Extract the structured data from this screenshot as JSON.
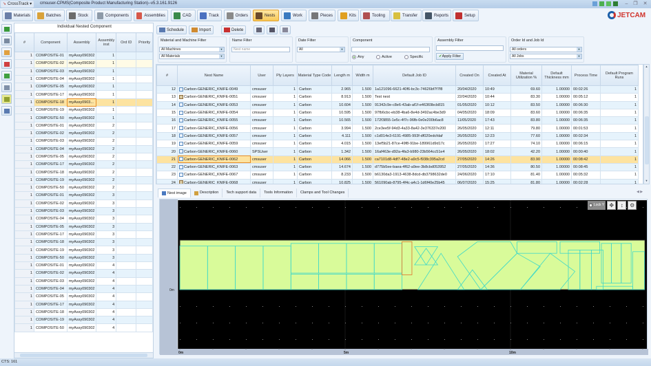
{
  "titlebar": {
    "app_menu": "CrossTrack",
    "title": "cmsuser-CPMS(Composite Product Manufacturing Station)--v5.3.161.9126"
  },
  "toolbar": {
    "items": [
      {
        "label": "Materials",
        "icon": "materials-icon",
        "color": "#6b7fa8"
      },
      {
        "label": "Batches",
        "icon": "box-icon",
        "color": "#d9a23a"
      },
      {
        "label": "Stock",
        "icon": "stack-icon",
        "color": "#6b6b6b"
      },
      {
        "label": "Components",
        "icon": "component-icon",
        "color": "#8d9aa8"
      },
      {
        "label": "Assemblies",
        "icon": "assemblies-icon",
        "color": "#d6584a"
      },
      {
        "label": "CAD",
        "icon": "cad-icon",
        "color": "#3a8a4a"
      },
      {
        "label": "Track",
        "icon": "chart-icon",
        "color": "#4a70c0"
      },
      {
        "label": "Orders",
        "icon": "orders-icon",
        "color": "#8a8a8a"
      },
      {
        "label": "Nests",
        "icon": "nests-icon",
        "color": "#6a4a2a",
        "active": true
      },
      {
        "label": "Work",
        "icon": "work-icon",
        "color": "#3a7ac0"
      },
      {
        "label": "Pieces",
        "icon": "pieces-icon",
        "color": "#777777"
      },
      {
        "label": "Kits",
        "icon": "kits-icon",
        "color": "#e0a020"
      },
      {
        "label": "Tooling",
        "icon": "tooling-icon",
        "color": "#b05050"
      },
      {
        "label": "Transfer",
        "icon": "forklift-icon",
        "color": "#d8c040"
      },
      {
        "label": "Reports",
        "icon": "grid-icon",
        "color": "#445566"
      },
      {
        "label": "Setup",
        "icon": "tools-icon",
        "color": "#c03030"
      }
    ]
  },
  "logo": "JETCAM",
  "left_panel": {
    "title": "Individual Nested Component",
    "columns": [
      "#",
      "Component",
      "Assembly",
      "Assembly inst",
      "Ord ID",
      "Priority"
    ],
    "assembly": "myAssy090302",
    "selected_assembly_truncated": "myAssy0903...",
    "rows": [
      [
        "1",
        "COMPOSITE-01",
        "myAssy090302",
        "1"
      ],
      [
        "1",
        "COMPOSITE-02",
        "myAssy090302",
        "1"
      ],
      [
        "1",
        "COMPOSITE-03",
        "myAssy090302",
        "1"
      ],
      [
        "1",
        "COMPOSITE-04",
        "myAssy090302",
        "1"
      ],
      [
        "1",
        "COMPOSITE-05",
        "myAssy090302",
        "1"
      ],
      [
        "1",
        "COMPOSITE-17",
        "myAssy090302",
        "1"
      ],
      [
        "1",
        "COMPOSITE-18",
        "myAssy0903...",
        "1"
      ],
      [
        "1",
        "COMPOSITE-19",
        "myAssy090302",
        "1"
      ],
      [
        "1",
        "COMPOSITE-50",
        "myAssy090302",
        "1"
      ],
      [
        "1",
        "COMPOSITE-01",
        "myAssy090302",
        "2"
      ],
      [
        "1",
        "COMPOSITE-02",
        "myAssy090302",
        "2"
      ],
      [
        "1",
        "COMPOSITE-03",
        "myAssy090302",
        "2"
      ],
      [
        "1",
        "COMPOSITE-04",
        "myAssy090302",
        "2"
      ],
      [
        "1",
        "COMPOSITE-05",
        "myAssy090302",
        "2"
      ],
      [
        "1",
        "COMPOSITE-17",
        "myAssy090302",
        "2"
      ],
      [
        "1",
        "COMPOSITE-18",
        "myAssy090302",
        "2"
      ],
      [
        "1",
        "COMPOSITE-19",
        "myAssy090302",
        "2"
      ],
      [
        "1",
        "COMPOSITE-50",
        "myAssy090302",
        "2"
      ],
      [
        "1",
        "COMPOSITE-01",
        "myAssy090302",
        "3"
      ],
      [
        "1",
        "COMPOSITE-02",
        "myAssy090302",
        "3"
      ],
      [
        "1",
        "COMPOSITE-03",
        "myAssy090302",
        "3"
      ],
      [
        "1",
        "COMPOSITE-04",
        "myAssy090302",
        "3"
      ],
      [
        "1",
        "COMPOSITE-05",
        "myAssy090302",
        "3"
      ],
      [
        "1",
        "COMPOSITE-17",
        "myAssy090302",
        "3"
      ],
      [
        "1",
        "COMPOSITE-18",
        "myAssy090302",
        "3"
      ],
      [
        "1",
        "COMPOSITE-19",
        "myAssy090302",
        "3"
      ],
      [
        "1",
        "COMPOSITE-50",
        "myAssy090302",
        "3"
      ],
      [
        "1",
        "COMPOSITE-01",
        "myAssy090302",
        "4"
      ],
      [
        "1",
        "COMPOSITE-02",
        "myAssy090302",
        "4"
      ],
      [
        "1",
        "COMPOSITE-03",
        "myAssy090302",
        "4"
      ],
      [
        "1",
        "COMPOSITE-04",
        "myAssy090302",
        "4"
      ],
      [
        "1",
        "COMPOSITE-05",
        "myAssy090302",
        "4"
      ],
      [
        "1",
        "COMPOSITE-17",
        "myAssy090302",
        "4"
      ],
      [
        "1",
        "COMPOSITE-18",
        "myAssy090302",
        "4"
      ],
      [
        "1",
        "COMPOSITE-19",
        "myAssy090302",
        "4"
      ],
      [
        "1",
        "COMPOSITE-50",
        "myAssy090302",
        "4"
      ]
    ],
    "selected_row": 6,
    "hover_row": 1
  },
  "actions": {
    "schedule": "Schedule",
    "import": "Import",
    "delete": "Delete"
  },
  "filters": {
    "material_machine": {
      "label": "Material and Machine Filter",
      "machine": "All Machines",
      "material": "All Materials"
    },
    "name": {
      "label": "Name Filter",
      "placeholder": "Nest name"
    },
    "date": {
      "label": "Date Filter",
      "value": "All"
    },
    "component": {
      "label": "Component",
      "value": "",
      "options": [
        "Any",
        "Active",
        "Specific"
      ],
      "selected": "Any"
    },
    "assembly": {
      "label": "Assembly Filter",
      "value": "",
      "apply": "Apply Filter"
    },
    "order_job": {
      "label": "Order Id and Job Id",
      "orders": "All orders",
      "jobs": "All Jobs"
    }
  },
  "nests": {
    "columns": [
      "#",
      "Nest Name",
      "User",
      "Ply Layers",
      "Material Type Code",
      "Length m",
      "Width m",
      "Default Job ID",
      "Created On",
      "Created At",
      "Material Utilization %",
      "Default Thickness mm",
      "Process Time",
      "Default Program Runs"
    ],
    "rows": [
      [
        "12",
        "Carbon-GENERIC_KNIFE-0049",
        "cmsuser",
        "1",
        "Carbon",
        "2.965",
        "1.500",
        "1a121096-6621-40f6-bc3c-74626bf7f7f8",
        "20/04/2020",
        "10:49",
        "69.60",
        "1.00000",
        "00:02:26",
        "1"
      ],
      [
        "13",
        "Carbon-GENERIC_KNIFE-0051",
        "cmsuser",
        "1",
        "Carbon",
        "8.913",
        "1.500",
        "Test nest",
        "22/04/2020",
        "10:44",
        "83.30",
        "1.00000",
        "00:05:12",
        "1"
      ],
      [
        "14",
        "Carbon-GENERIC_KNIFE-0053",
        "cmsuser",
        "1",
        "Carbon",
        "10.604",
        "1.500",
        "91342c9e-c8e6-43ab-af1f-e46369bcb815",
        "01/05/2020",
        "10:12",
        "83.50",
        "1.00000",
        "00:06:30",
        "1"
      ],
      [
        "15",
        "Carbon-GENERIC_KNIFE-0054",
        "cmsuser",
        "1",
        "Carbon",
        "10.595",
        "1.500",
        "97fb6cbc-eb38-4ba6-8e4d-3492ac4be3d9",
        "04/05/2020",
        "18:09",
        "83.60",
        "1.00000",
        "00:06:35",
        "1"
      ],
      [
        "16",
        "Carbon-GENERIC_KNIFE-0055",
        "cmsuser",
        "1",
        "Carbon",
        "10.565",
        "1.500",
        "172f3855-1e5c-4f7c-96fb-0e0e200b6ac8",
        "11/05/2020",
        "17:43",
        "83.80",
        "1.00000",
        "00:06:35",
        "1"
      ],
      [
        "17",
        "Carbon-GENERIC_KNIFE-0056",
        "cmsuser",
        "1",
        "Carbon",
        "3.994",
        "1.500",
        "2ce3ee5f-94d3-4a33-8a42-3e376337e200",
        "26/05/2020",
        "12:11",
        "79.80",
        "1.00000",
        "00:01:53",
        "1"
      ],
      [
        "18",
        "Carbon-GENERIC_KNIFE-0057",
        "cmsuser",
        "1",
        "Carbon",
        "4.111",
        "1.500",
        "c1d014e3-6191-4985-993f-df020edcfdaf",
        "26/05/2020",
        "12:23",
        "77.60",
        "1.00000",
        "00:02:34",
        "1"
      ],
      [
        "19",
        "Carbon-GENERIC_KNIFE-0059",
        "cmsuser",
        "1",
        "Carbon",
        "4.015",
        "1.500",
        "13ef5b21-87ce-49f8-91be-189961d9d17c",
        "26/05/2020",
        "17:27",
        "74.10",
        "1.00000",
        "00:06:15",
        "1"
      ],
      [
        "20",
        "Carbon-GENERIC_KNIFE-0060",
        "SPSUser",
        "1",
        "Carbon",
        "1.342",
        "1.500",
        "16af463e-d92a-4fa3-b980-23b564cc51e4",
        "26/05/2020",
        "18:02",
        "42.20",
        "1.00000",
        "00:00:40",
        "1"
      ],
      [
        "21",
        "Carbon-GENERIC_KNIFE-0062",
        "cmsuser",
        "1",
        "Carbon",
        "14.066",
        "1.500",
        "ca7101d8-4df7-48e2-a9c5-f938c395a2cd",
        "27/05/2020",
        "14:26",
        "83.90",
        "1.00000",
        "00:08:42",
        "1"
      ],
      [
        "22",
        "Carbon-GENERIC_KNIFE-0063",
        "cmsuser",
        "1",
        "Carbon",
        "14.674",
        "1.500",
        "d775b5ee-baea-4f62-a9ee-3b8cbd053952",
        "27/05/2020",
        "14:36",
        "80.50",
        "1.00000",
        "00:08:45",
        "1"
      ],
      [
        "23",
        "Carbon-GENERIC_KNIFE-0067",
        "cmsuser",
        "1",
        "Carbon",
        "8.233",
        "1.500",
        "b6130da3-1913-4638-8dcd-db3798632de0",
        "24/06/2020",
        "17:10",
        "81.40",
        "1.00000",
        "00:05:32",
        "1"
      ],
      [
        "24",
        "Carbon-GENERIC_KNIFE-0068",
        "cmsuser",
        "1",
        "Carbon",
        "10.825",
        "1.500",
        "561090ab-8795-4f4c-a4c1-1d6f40e25b45",
        "06/07/2020",
        "15:25",
        "81.80",
        "1.00000",
        "00:02:28",
        "1"
      ]
    ],
    "selected_row": 9,
    "alt_icon_rows": [
      1,
      12
    ]
  },
  "detail_tabs": [
    "Nest image",
    "Description",
    "Tech support data",
    "Tools Information",
    "Clamps and Tool Changes"
  ],
  "active_tab": "Nest image",
  "nest_image": {
    "lock_label": "Lock Y",
    "x_tick_labels": [
      "0m",
      "5m",
      "10m"
    ],
    "y_tick_label": "0m",
    "sheet_length_m": 14.066,
    "sheet_width_m": 1.5,
    "colors": {
      "background": "#000000",
      "sheet": "#d9fb9a",
      "part_outline": "#3fd8c8",
      "selected_part": "#e0702a"
    }
  },
  "status": "CTS: 161",
  "colors": {
    "accent": "#f8c957",
    "selected_row": "#fde3a0",
    "alt_row": "#e6f3fc"
  }
}
